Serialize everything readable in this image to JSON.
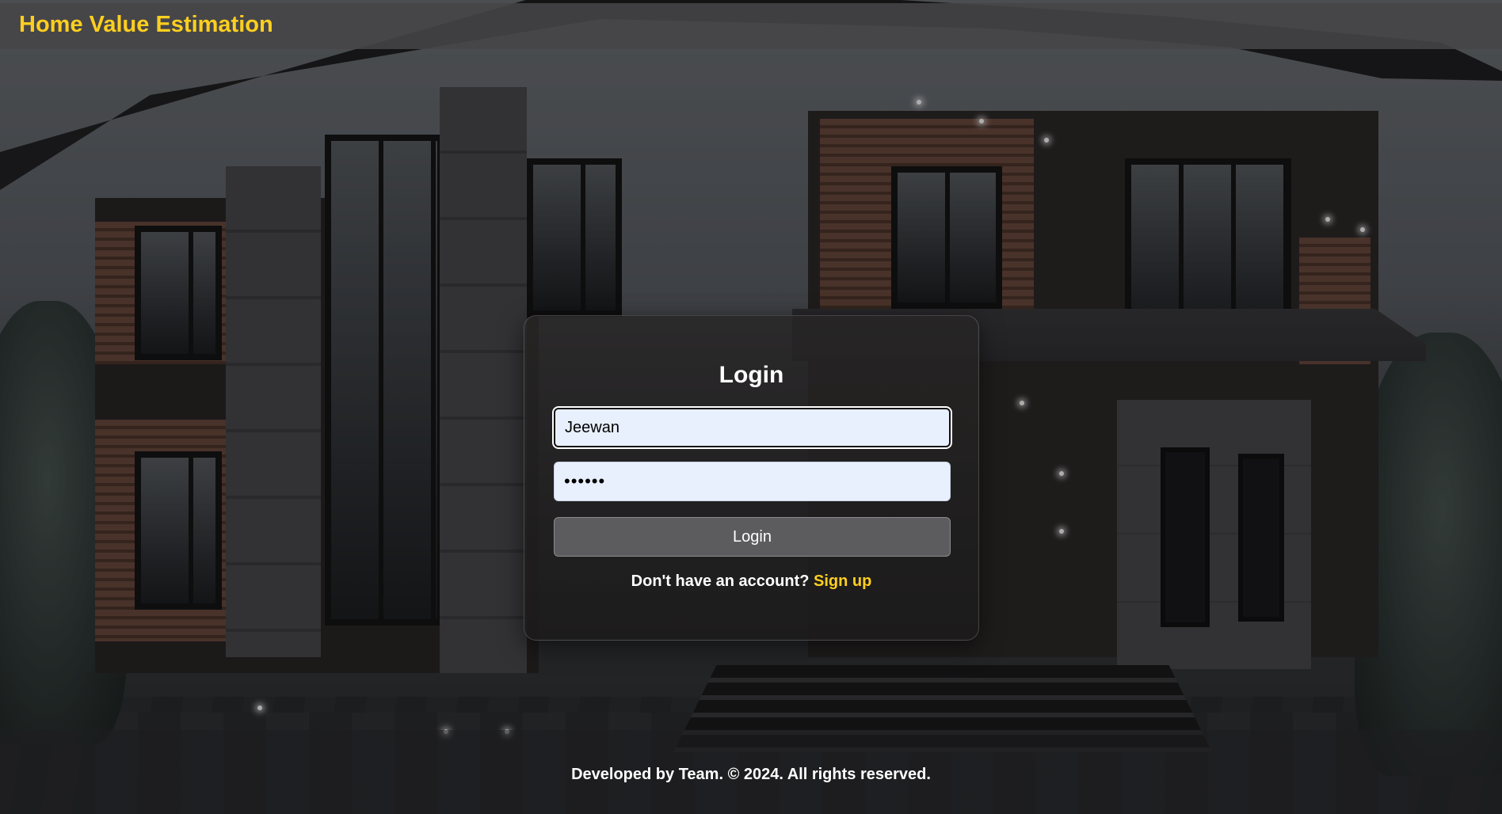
{
  "header": {
    "app_title": "Home Value Estimation"
  },
  "login_form": {
    "title": "Login",
    "username_value": "Jeewan",
    "password_value": "••••••",
    "login_button_label": "Login",
    "signup_prompt": "Don't have an account?",
    "signup_link_label": "Sign up"
  },
  "footer": {
    "text": "Developed by Team. © 2024. All rights reserved."
  },
  "colors": {
    "accent": "#ffcf1f",
    "input_bg": "#e8f0fe",
    "button_bg": "#5c5c5e"
  },
  "icons": {
    "background": "house-photo"
  }
}
